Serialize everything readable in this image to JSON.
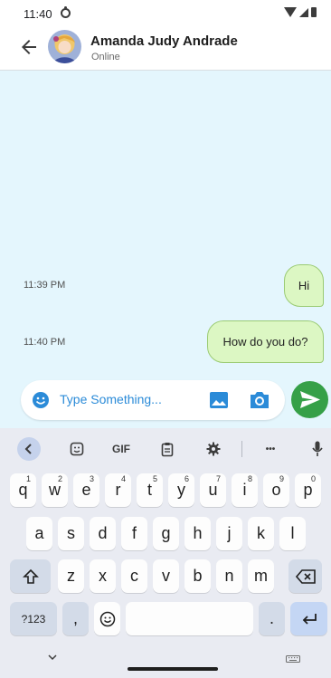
{
  "status_bar": {
    "time": "11:40"
  },
  "header": {
    "contact_name": "Amanda Judy Andrade",
    "contact_status": "Online"
  },
  "messages": [
    {
      "time": "11:39 PM",
      "text": "Hi"
    },
    {
      "time": "11:40 PM",
      "text": "How do you do?"
    }
  ],
  "composer": {
    "placeholder": "Type Something..."
  },
  "keyboard": {
    "toolbar": {
      "gif_label": "GIF",
      "more_label": "•••"
    },
    "rows": [
      [
        {
          "label": "q",
          "sup": "1"
        },
        {
          "label": "w",
          "sup": "2"
        },
        {
          "label": "e",
          "sup": "3"
        },
        {
          "label": "r",
          "sup": "4"
        },
        {
          "label": "t",
          "sup": "5"
        },
        {
          "label": "y",
          "sup": "6"
        },
        {
          "label": "u",
          "sup": "7"
        },
        {
          "label": "i",
          "sup": "8"
        },
        {
          "label": "o",
          "sup": "9"
        },
        {
          "label": "p",
          "sup": "0"
        }
      ],
      [
        {
          "label": "a"
        },
        {
          "label": "s"
        },
        {
          "label": "d"
        },
        {
          "label": "f"
        },
        {
          "label": "g"
        },
        {
          "label": "h"
        },
        {
          "label": "j"
        },
        {
          "label": "k"
        },
        {
          "label": "l"
        }
      ],
      [
        {
          "label": "z"
        },
        {
          "label": "x"
        },
        {
          "label": "c"
        },
        {
          "label": "v"
        },
        {
          "label": "b"
        },
        {
          "label": "n"
        },
        {
          "label": "m"
        }
      ]
    ],
    "symbols_label": "?123",
    "comma_label": ",",
    "period_label": "."
  },
  "colors": {
    "chat_bg": "#e4f6fd",
    "bubble_bg": "#dcf7c3",
    "bubble_border": "#9bcb74",
    "send_green": "#36a048",
    "accent_blue": "#2b8bd8"
  }
}
